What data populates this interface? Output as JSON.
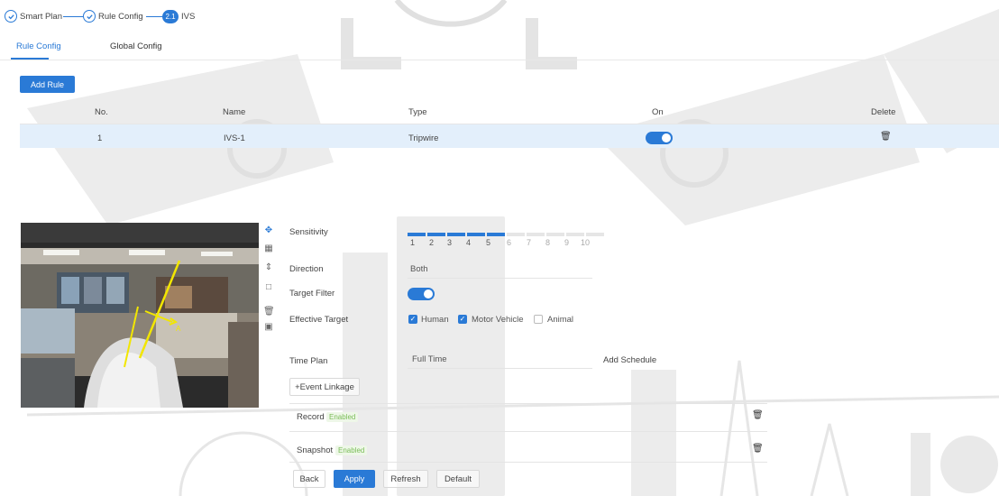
{
  "steps": [
    {
      "label": "Smart Plan"
    },
    {
      "label": "Rule Config"
    },
    {
      "label": "IVS",
      "number": "2.1"
    }
  ],
  "tabs": [
    {
      "label": "Rule Config",
      "active": true
    },
    {
      "label": "Global Config",
      "active": false
    }
  ],
  "add_rule_label": "Add Rule",
  "table": {
    "headers": [
      "No.",
      "Name",
      "Type",
      "On",
      "Delete"
    ],
    "rows": [
      {
        "no": "1",
        "name": "IVS-1",
        "type": "Tripwire",
        "on": true
      }
    ]
  },
  "toolbar_icons": [
    "move-icon",
    "draw-region-icon",
    "target-filter-icon",
    "max-size-icon",
    "delete-drawing-icon",
    "pixel-counter-icon"
  ],
  "form": {
    "sensitivity": {
      "label": "Sensitivity",
      "value": 5,
      "ticks": [
        "1",
        "2",
        "3",
        "4",
        "5",
        "6",
        "7",
        "8",
        "9",
        "10"
      ]
    },
    "direction": {
      "label": "Direction",
      "value": "Both"
    },
    "target_filter": {
      "label": "Target Filter",
      "on": true
    },
    "effective_target": {
      "label": "Effective Target",
      "options": [
        {
          "label": "Human",
          "checked": true
        },
        {
          "label": "Motor Vehicle",
          "checked": true
        },
        {
          "label": "Animal",
          "checked": false
        }
      ]
    },
    "time_plan": {
      "label": "Time Plan",
      "value": "Full Time",
      "add_schedule": "Add Schedule"
    },
    "event_linkage": "+Event Linkage",
    "record": {
      "label": "Record",
      "status": "Enabled"
    },
    "snapshot": {
      "label": "Snapshot",
      "status": "Enabled"
    }
  },
  "buttons": {
    "back": "Back",
    "apply": "Apply",
    "refresh": "Refresh",
    "default": "Default"
  },
  "colors": {
    "accent": "#2a7ad6",
    "row_highlight": "#e3effb",
    "enabled": "#7bbd59",
    "tripwire": "#f2e600"
  }
}
